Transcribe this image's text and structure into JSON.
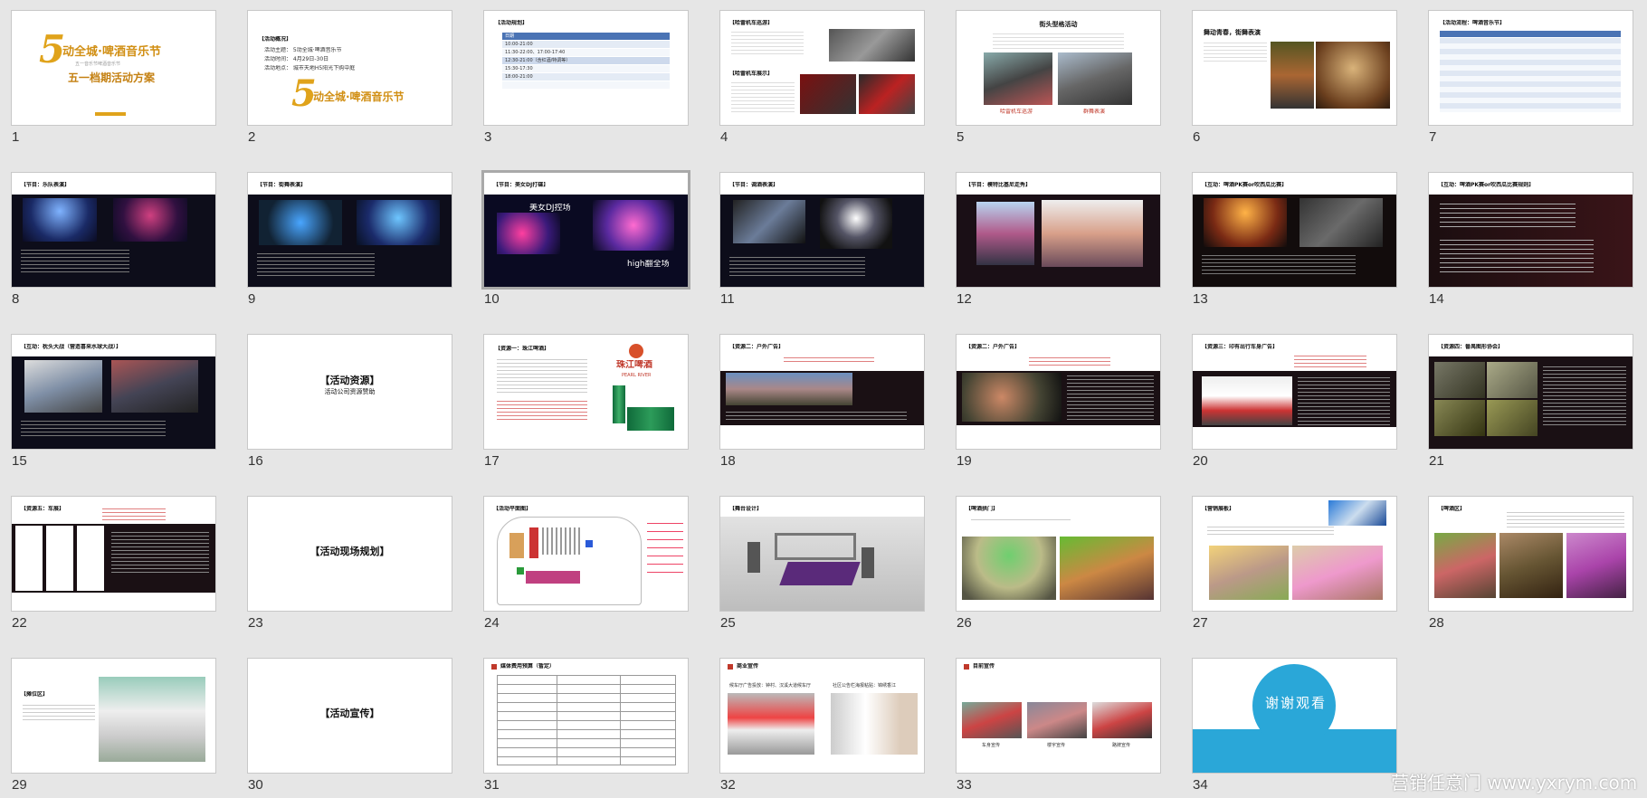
{
  "slides": [
    {
      "n": "1",
      "title": "动全城·啤酒音乐节",
      "subtitle": "五一档期活动方案",
      "tag": "五一音乐节啤酒音乐节"
    },
    {
      "n": "2",
      "heading": "【活动概况】",
      "lines": [
        "活动主题：  5动全城·啤酒音乐节",
        "活动时间：  4月29日-30日",
        "活动地点：  城市天地H5阳光下购中庭"
      ],
      "logo": "动全城·啤酒音乐节"
    },
    {
      "n": "3",
      "heading": "【活动规划】",
      "rows": [
        "日期",
        "10:00-21:00",
        "11:30-22:00、17:00-17:40",
        "12:30-21:00（含红酒/特调等）",
        "15:30-17:30",
        "18:00-21:00",
        ""
      ]
    },
    {
      "n": "4",
      "heading": "【哈雷机车巡游】",
      "heading2": "【哈雷机车展示】"
    },
    {
      "n": "5",
      "title": "街头型格活动",
      "cap1": "哈雷机车巡游",
      "cap2": "群舞表演"
    },
    {
      "n": "6",
      "title": "舞动青春，街舞表演"
    },
    {
      "n": "7",
      "heading": "【活动流程：啤酒音乐节】"
    },
    {
      "n": "8",
      "heading": "【节目：乐队表演】"
    },
    {
      "n": "9",
      "heading": "【节目：街舞表演】"
    },
    {
      "n": "10",
      "heading": "【节目：美女DJ打碟】",
      "overlay1": "美女DJ控场",
      "overlay2": "high翻全场"
    },
    {
      "n": "11",
      "heading": "【节目：调酒表演】"
    },
    {
      "n": "12",
      "heading": "【节目：模特比基尼走秀】"
    },
    {
      "n": "13",
      "heading": "【互动：啤酒PK赛or吹西瓜比赛】"
    },
    {
      "n": "14",
      "heading": "【互动：啤酒PK赛or吹西瓜比赛规则】"
    },
    {
      "n": "15",
      "heading": "【互动：枕头大战（营造喜来水球大战）】"
    },
    {
      "n": "16",
      "title": "【活动资源】",
      "subtitle": "活动公司资源赞助"
    },
    {
      "n": "17",
      "heading": "【资源一：珠江啤酒】",
      "brand": "珠江啤酒",
      "brand_en": "PEARL RIVER"
    },
    {
      "n": "18",
      "heading": "【资源二：户外广告】"
    },
    {
      "n": "19",
      "heading": "【资源二：户外广告】"
    },
    {
      "n": "20",
      "heading": "【资源三：印有出行车身广告】"
    },
    {
      "n": "21",
      "heading": "【资源四：番禺图形协会】"
    },
    {
      "n": "22",
      "heading": "【资源五：车展】"
    },
    {
      "n": "23",
      "title": "【活动现场规划】"
    },
    {
      "n": "24",
      "heading": "【活动平面图】"
    },
    {
      "n": "25",
      "heading": "【舞台设计】"
    },
    {
      "n": "26",
      "heading": "【啤酒拱门】"
    },
    {
      "n": "27",
      "heading": "【营销展板】"
    },
    {
      "n": "28",
      "heading": "【啤酒区】"
    },
    {
      "n": "29",
      "heading": "【摊位区】"
    },
    {
      "n": "30",
      "title": "【活动宣传】"
    },
    {
      "n": "31",
      "heading": "媒体费用预算（暂定）"
    },
    {
      "n": "32",
      "heading": "商业宣传",
      "cap1": "候车厅广告投放：钟村、汉溪大道候车厅",
      "cap2": "社区公告栏海报粘贴：锦绣香江"
    },
    {
      "n": "33",
      "heading": "目前宣传",
      "cap1": "车身宣传",
      "cap2": "楼宇宣传",
      "cap3": "路牌宣传"
    },
    {
      "n": "34",
      "title": "谢谢观看"
    }
  ],
  "watermark": "营销任意门 www.yxrym.com",
  "colors": {
    "accent": "#c0392b",
    "gold": "#e0a31b",
    "selection": "#a9a9a9",
    "thanks_blue": "#2aa7d8"
  }
}
